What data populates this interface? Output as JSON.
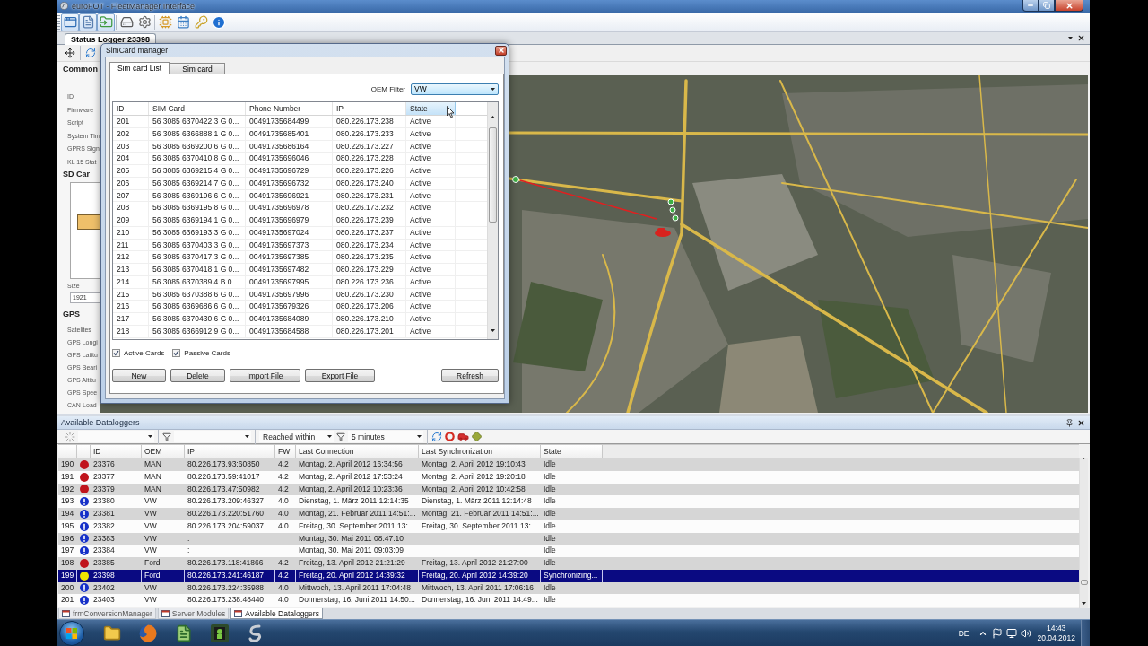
{
  "window": {
    "title": "euroFOT - FleetManager Interface"
  },
  "toolbar": {
    "view_buttons": [
      {
        "pressed": true
      },
      {
        "pressed": true
      },
      {
        "pressed": true
      }
    ]
  },
  "document_tabs": [
    {
      "label": "Status Logger 23398",
      "selected": true
    }
  ],
  "status_logger": {
    "heading": "Common",
    "fields": [
      "ID",
      "Firmware",
      "Script",
      "System Tim",
      "GPRS Sign",
      "KL 15 Stat"
    ],
    "sd_card": {
      "heading": "SD Car",
      "size_label": "Size",
      "size_value": "1921"
    },
    "gps": {
      "heading": "GPS",
      "fields": [
        "Satelites",
        "GPS Longi",
        "GPS Latitu",
        "GPS Beari",
        "GPS Altitu",
        "GPS Spee",
        "CAN-Load"
      ]
    }
  },
  "sim_card_manager": {
    "title": "SimCard manager",
    "tabs": [
      {
        "label": "Sim card List",
        "selected": true
      },
      {
        "label": "Sim card",
        "selected": false
      }
    ],
    "oem_filter": {
      "label": "OEM Filter",
      "value": "VW"
    },
    "table": {
      "columns": [
        {
          "label": "ID",
          "highlighted": false
        },
        {
          "label": "SIM Card",
          "highlighted": false
        },
        {
          "label": "Phone Number",
          "highlighted": false
        },
        {
          "label": "IP",
          "highlighted": false
        },
        {
          "label": "State",
          "highlighted": true
        }
      ],
      "rows": [
        [
          "201",
          "56 3085 6370422 3 G 0...",
          "00491735684499",
          "080.226.173.238",
          "Active"
        ],
        [
          "202",
          "56 3085 6366888 1 G 0...",
          "00491735685401",
          "080.226.173.233",
          "Active"
        ],
        [
          "203",
          "56 3085 6369200 6 G 0...",
          "00491735686164",
          "080.226.173.227",
          "Active"
        ],
        [
          "204",
          "56 3085 6370410 8 G 0...",
          "00491735696046",
          "080.226.173.228",
          "Active"
        ],
        [
          "205",
          "56 3085 6369215 4 G 0...",
          "00491735696729",
          "080.226.173.226",
          "Active"
        ],
        [
          "206",
          "56 3085 6369214 7 G 0...",
          "00491735696732",
          "080.226.173.240",
          "Active"
        ],
        [
          "207",
          "56 3085 6369196 6 G 0...",
          "00491735696921",
          "080.226.173.231",
          "Active"
        ],
        [
          "208",
          "56 3085 6369195 8 G 0...",
          "00491735696978",
          "080.226.173.232",
          "Active"
        ],
        [
          "209",
          "56 3085 6369194 1 G 0...",
          "00491735696979",
          "080.226.173.239",
          "Active"
        ],
        [
          "210",
          "56 3085 6369193 3 G 0...",
          "00491735697024",
          "080.226.173.237",
          "Active"
        ],
        [
          "211",
          "56 3085 6370403 3 G 0...",
          "00491735697373",
          "080.226.173.234",
          "Active"
        ],
        [
          "212",
          "56 3085 6370417 3 G 0...",
          "00491735697385",
          "080.226.173.235",
          "Active"
        ],
        [
          "213",
          "56 3085 6370418 1 G 0...",
          "00491735697482",
          "080.226.173.229",
          "Active"
        ],
        [
          "214",
          "56 3085 6370389 4 B 0...",
          "00491735697995",
          "080.226.173.236",
          "Active"
        ],
        [
          "215",
          "56 3085 6370388 6 G 0...",
          "00491735697996",
          "080.226.173.230",
          "Active"
        ],
        [
          "216",
          "56 3085 6369686 6 G 0...",
          "00491735679326",
          "080.226.173.206",
          "Active"
        ],
        [
          "217",
          "56 3085 6370430 6 G 0...",
          "00491735684089",
          "080.226.173.210",
          "Active"
        ],
        [
          "218",
          "56 3085 6366912 9 G 0...",
          "00491735684588",
          "080.226.173.201",
          "Active"
        ]
      ]
    },
    "checkboxes": [
      {
        "label": "Active Cards",
        "checked": true
      },
      {
        "label": "Passive Cards",
        "checked": true
      }
    ],
    "buttons": [
      "New",
      "Delete",
      "Import File",
      "Export File",
      "Refresh"
    ]
  },
  "dataloggers": {
    "title": "Available Dataloggers",
    "toolbar": {
      "range_filter": "Reached within",
      "time_filter": "5 minutes"
    },
    "columns": [
      "ID",
      "OEM",
      "IP",
      "FW",
      "Last Connection",
      "Last Synchronization",
      "State"
    ],
    "rows": [
      {
        "number": "190",
        "kind": "dot",
        "color": "#c0141c",
        "id": "23376",
        "oem": "MAN",
        "ip": "80.226.173.93:60850",
        "fw": "4.2",
        "last_connection": "Montag, 2. April 2012 16:34:56",
        "last_synchronization": "Montag, 2. April 2012 19:10:43",
        "state": "Idle",
        "selected": false
      },
      {
        "number": "191",
        "kind": "dot",
        "color": "#c0141c",
        "id": "23377",
        "oem": "MAN",
        "ip": "80.226.173.59:41017",
        "fw": "4.2",
        "last_connection": "Montag, 2. April 2012 17:53:24",
        "last_synchronization": "Montag, 2. April 2012 19:20:18",
        "state": "Idle",
        "selected": false
      },
      {
        "number": "192",
        "kind": "dot",
        "color": "#c0141c",
        "id": "23379",
        "oem": "MAN",
        "ip": "80.226.173.47:50982",
        "fw": "4.2",
        "last_connection": "Montag, 2. April 2012 10:23:36",
        "last_synchronization": "Montag, 2. April 2012 10:42:58",
        "state": "Idle",
        "selected": false
      },
      {
        "number": "193",
        "kind": "alert",
        "id": "23380",
        "oem": "VW",
        "ip": "80.226.173.209:46327",
        "fw": "4.0",
        "last_connection": "Dienstag, 1. März 2011 12:14:35",
        "last_synchronization": "Dienstag, 1. März 2011 12:14:48",
        "state": "Idle",
        "selected": false
      },
      {
        "number": "194",
        "kind": "alert",
        "id": "23381",
        "oem": "VW",
        "ip": "80.226.173.220:51760",
        "fw": "4.0",
        "last_connection": "Montag, 21. Februar 2011 14:51:...",
        "last_synchronization": "Montag, 21. Februar 2011 14:51:...",
        "state": "Idle",
        "selected": false
      },
      {
        "number": "195",
        "kind": "alert",
        "id": "23382",
        "oem": "VW",
        "ip": "80.226.173.204:59037",
        "fw": "4.0",
        "last_connection": "Freitag, 30. September 2011 13:...",
        "last_synchronization": "Freitag, 30. September 2011 13:...",
        "state": "Idle",
        "selected": false
      },
      {
        "number": "196",
        "kind": "alert",
        "id": "23383",
        "oem": "VW",
        "ip": ":",
        "last_connection": "Montag, 30. Mai 2011 08:47:10",
        "state": "Idle",
        "selected": false
      },
      {
        "number": "197",
        "kind": "alert",
        "id": "23384",
        "oem": "VW",
        "ip": ":",
        "last_connection": "Montag, 30. Mai 2011 09:03:09",
        "state": "Idle",
        "selected": false
      },
      {
        "number": "198",
        "kind": "dot",
        "color": "#c0141c",
        "id": "23385",
        "oem": "Ford",
        "ip": "80.226.173.118:41866",
        "fw": "4.2",
        "last_connection": "Freitag, 13. April 2012 21:21:29",
        "last_synchronization": "Freitag, 13. April 2012 21:27:00",
        "state": "Idle",
        "selected": false
      },
      {
        "number": "199",
        "kind": "dot",
        "color": "#f2e600",
        "id": "23398",
        "oem": "Ford",
        "ip": "80.226.173.241:46187",
        "fw": "4.2",
        "last_connection": "Freitag, 20. April 2012 14:39:32",
        "last_synchronization": "Freitag, 20. April 2012 14:39:20",
        "state": "Synchronizing...",
        "selected": true
      },
      {
        "number": "200",
        "kind": "alert",
        "id": "23402",
        "oem": "VW",
        "ip": "80.226.173.224:35988",
        "fw": "4.0",
        "last_connection": "Mittwoch, 13. April 2011 17:04:48",
        "last_synchronization": "Mittwoch, 13. April 2011 17:06:16",
        "state": "Idle",
        "selected": false
      },
      {
        "number": "201",
        "kind": "alert",
        "id": "23403",
        "oem": "VW",
        "ip": "80.226.173.238:48440",
        "fw": "4.0",
        "last_connection": "Donnerstag, 16. Juni 2011 14:50...",
        "last_synchronization": "Donnerstag, 16. Juni 2011 14:49...",
        "state": "Idle",
        "selected": false
      }
    ]
  },
  "bottom_tabs": [
    {
      "label": "frmConversionManager",
      "selected": false
    },
    {
      "label": "Server Modules",
      "selected": false
    },
    {
      "label": "Available Dataloggers",
      "selected": true
    }
  ],
  "taskbar": {
    "language": "DE",
    "time": "14:43",
    "date": "20.04.2012"
  }
}
